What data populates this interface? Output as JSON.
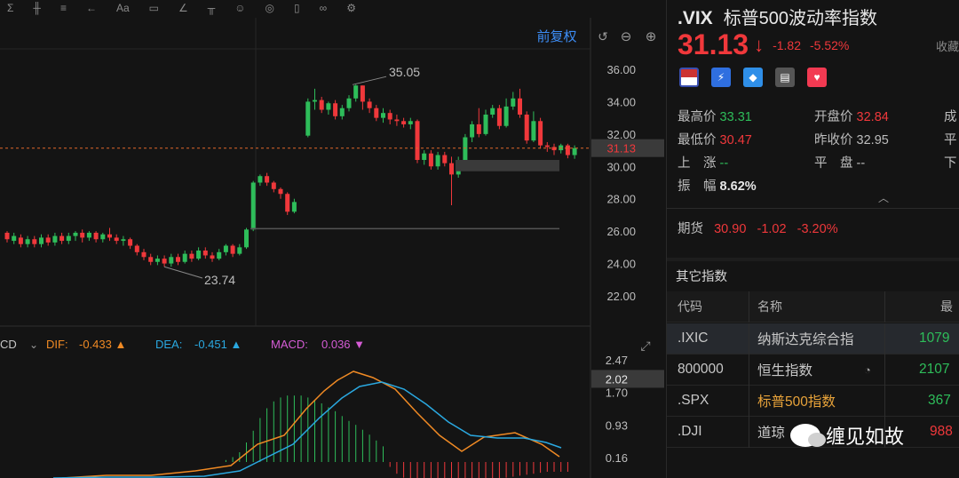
{
  "toolbar": {
    "items": [
      "Σ",
      "╫",
      "≡",
      "←",
      "Aa",
      "▭",
      "∠",
      "╥",
      "☺",
      "◎",
      "▯",
      "∞",
      "⚙"
    ]
  },
  "chart": {
    "adjust_label": "前复权",
    "price_axis": [
      "36.00",
      "34.00",
      "32.00",
      "30.00",
      "28.00",
      "26.00",
      "24.00",
      "22.00"
    ],
    "current_price_tag": "31.13",
    "high_label": "35.05",
    "low_label": "23.74",
    "macd_prefix": "CD",
    "dif_label": "DIF:",
    "dif_value": "-0.433",
    "dea_label": "DEA:",
    "dea_value": "-0.451",
    "macd_label": "MACD:",
    "macd_value": "0.036",
    "macd_axis": [
      "2.47",
      "1.70",
      "0.93",
      "0.16"
    ],
    "macd_tag": "2.02",
    "colors": {
      "up": "#f0383b",
      "down": "#2ebd5a",
      "dif": "#f08a24",
      "dea": "#2aa8e0",
      "macd": "#d55cd5"
    }
  },
  "quote": {
    "code": ".VIX",
    "name": "标普500波动率指数",
    "price": "31.13",
    "change": "-1.82",
    "change_pct": "-5.52%",
    "favorite": "收藏",
    "stats": {
      "high_label": "最高价",
      "high": "33.31",
      "open_label": "开盘价",
      "open": "32.84",
      "low_label": "最低价",
      "low": "30.47",
      "prev_close_label": "昨收价",
      "prev_close": "32.95",
      "up_label": "上　涨",
      "up": "--",
      "flat_label": "平　盘",
      "flat": "--",
      "amp_label": "振　幅",
      "amp": "8.62%",
      "col3_row1": "成",
      "col3_row2": "平",
      "col3_row3": "下"
    },
    "futures": {
      "label": "期货",
      "price": "30.90",
      "change": "-1.02",
      "change_pct": "-3.20%"
    }
  },
  "other_indices": {
    "title": "其它指数",
    "headers": {
      "code": "代码",
      "name": "名称",
      "last": "最"
    },
    "rows": [
      {
        "code": ".IXIC",
        "name": "纳斯达克综合指",
        "last": "1079"
      },
      {
        "code": "800000",
        "name": "恒生指数",
        "last": "2107"
      },
      {
        "code": ".SPX",
        "name": "标普500指数",
        "last": "367"
      },
      {
        "code": ".DJI",
        "name": "道琼",
        "last": "988"
      }
    ]
  },
  "watermark": {
    "text": "缠见如故"
  }
}
